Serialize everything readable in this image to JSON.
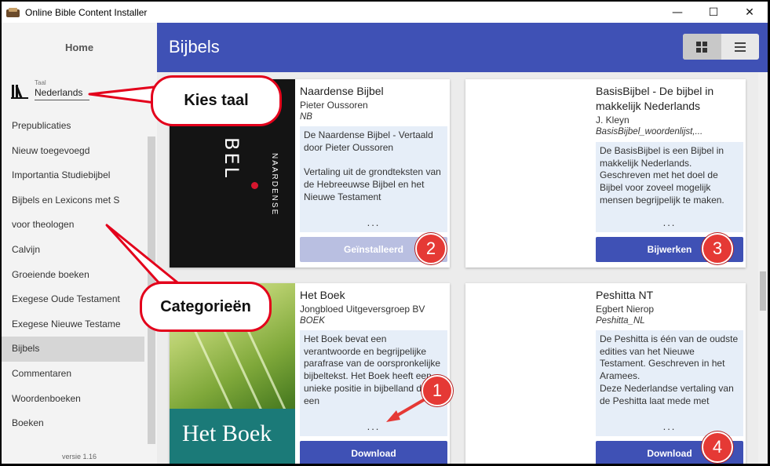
{
  "window": {
    "title": "Online Bible Content Installer",
    "controls": {
      "minimize": "—",
      "maximize": "☐",
      "close": "✕"
    }
  },
  "sidebar": {
    "home": "Home",
    "language": {
      "label": "Taal",
      "value": "Nederlands"
    },
    "categories": [
      "Prepublicaties",
      "Nieuw toegevoegd",
      "Importantia Studiebijbel",
      "Bijbels en Lexicons met S",
      "voor theologen",
      "Calvijn",
      "Groeiende boeken",
      "Exegese Oude Testament",
      "Exegese Nieuwe Testame",
      "Bijbels",
      "Commentaren",
      "Woordenboeken",
      "Boeken"
    ],
    "active_category": "Bijbels",
    "version": "versie 1.16"
  },
  "header": {
    "title": "Bijbels"
  },
  "cards": [
    {
      "title": "Naardense Bijbel",
      "author": "Pieter Oussoren",
      "code": "NB",
      "description": "De Naardense Bijbel - Vertaald door Pieter Oussoren\n\nVertaling uit de grondteksten van de Hebreeuwse Bijbel en het Nieuwe Testament",
      "cover_text": {
        "bel": "BEL",
        "name": "NAARDENSE"
      },
      "more": "...",
      "button": "Geïnstalleerd"
    },
    {
      "title": "BasisBijbel - De bijbel in makkelijk Nederlands",
      "author": "J. Kleyn",
      "code": "BasisBijbel_woordenlijst,...",
      "description": "De BasisBijbel is een Bijbel in makkelijk Nederlands. Geschreven met het doel de Bijbel voor zoveel mogelijk mensen begrijpelijk te maken.",
      "more": "...",
      "button": "Bijwerken"
    },
    {
      "title": "Het Boek",
      "author": "Jongbloed Uitgeversgroep BV",
      "code": "BOEK",
      "description": "Het Boek bevat een verantwoorde en begrijpelijke parafrase van de oorspronkelijke bijbeltekst. Het Boek heeft een unieke positie in bijbelland door een",
      "cover_text": {
        "title": "Het Boek"
      },
      "more": "...",
      "button": "Download"
    },
    {
      "title": "Peshitta NT",
      "author": "Egbert Nierop",
      "code": "Peshitta_NL",
      "description": "De Peshitta is één van de oudste edities van het Nieuwe Testament. Geschreven in het Aramees.\nDeze Nederlandse vertaling van de Peshitta laat mede met",
      "more": "...",
      "button": "Download"
    }
  ],
  "annotations": {
    "callout_language": "Kies taal",
    "callout_categories": "Categorieën",
    "badges": [
      "1",
      "2",
      "3",
      "4"
    ]
  },
  "colors": {
    "header": "#3f51b5",
    "button": "#3f51b5",
    "button_installed": "#b9bfe1",
    "description_bg": "#e6eef8",
    "annotation_red": "#e3001b"
  }
}
